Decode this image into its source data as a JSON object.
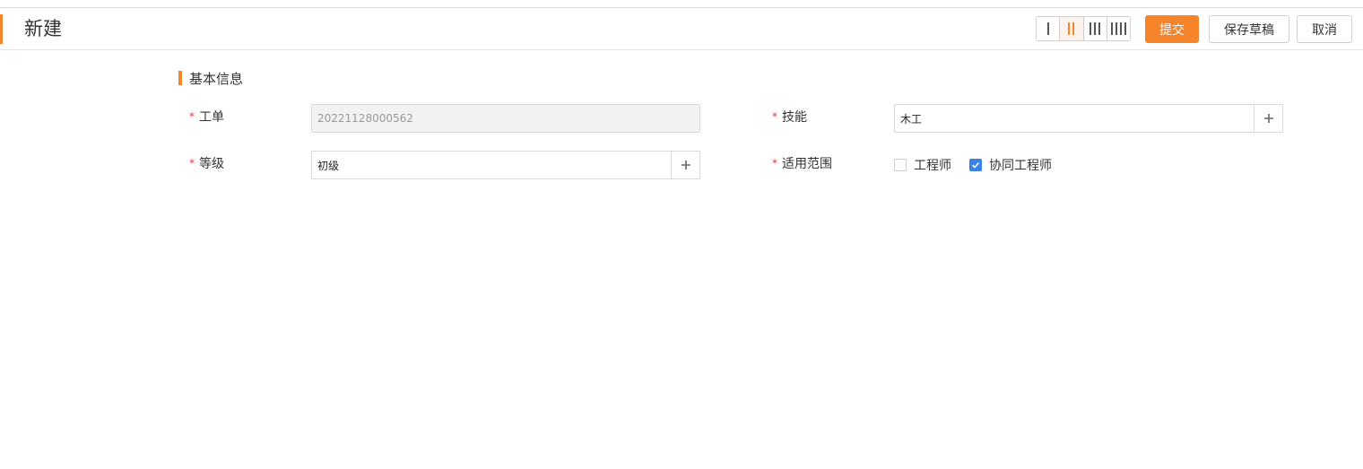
{
  "header": {
    "title": "新建",
    "layout_options": [
      "1-column",
      "2-column",
      "3-column",
      "4-column"
    ],
    "active_layout": "2-column",
    "submit_label": "提交",
    "save_draft_label": "保存草稿",
    "cancel_label": "取消",
    "accent_color": "#f5842a"
  },
  "section": {
    "title": "基本信息"
  },
  "fields": {
    "work_order": {
      "required_mark": "*",
      "label": "工单",
      "value": "20221128000562",
      "disabled": true
    },
    "skill": {
      "required_mark": "*",
      "label": "技能",
      "value": "木工"
    },
    "level": {
      "required_mark": "*",
      "label": "等级",
      "value": "初级"
    },
    "scope": {
      "required_mark": "*",
      "label": "适用范围",
      "options": [
        {
          "label": "工程师",
          "checked": false
        },
        {
          "label": "协同工程师",
          "checked": true
        }
      ]
    }
  },
  "icons": {
    "add": "plus-icon",
    "check": "check-icon"
  }
}
